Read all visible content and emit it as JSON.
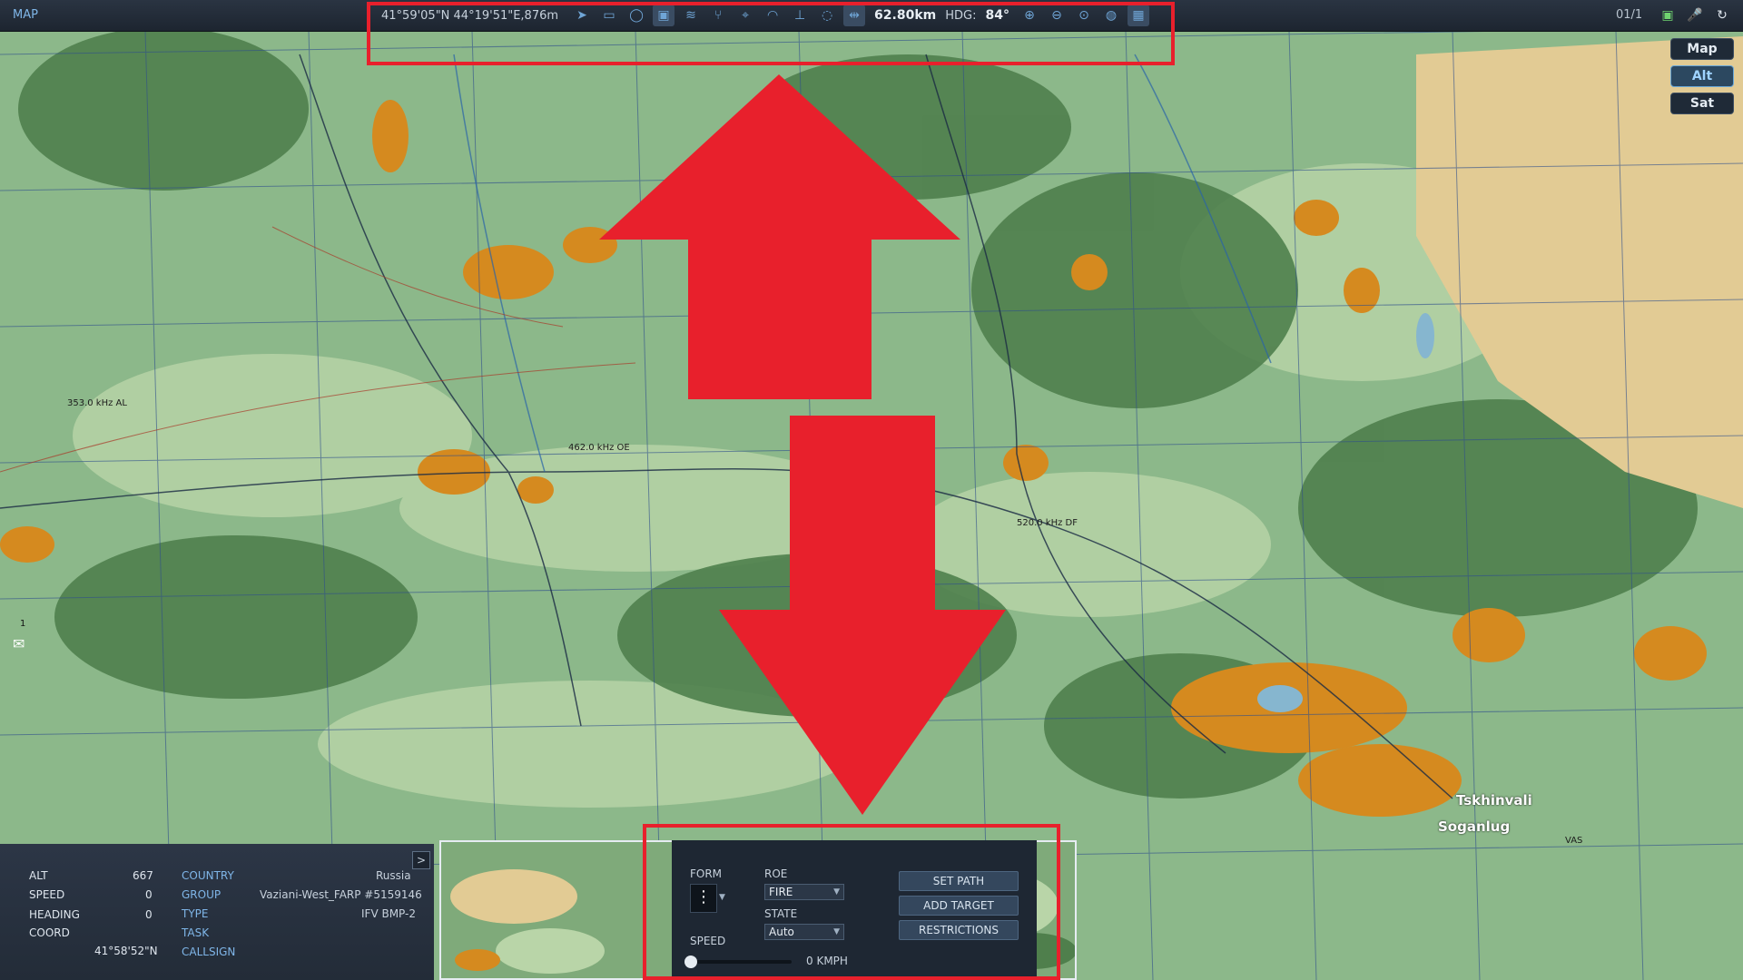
{
  "app": {
    "map_label": "MAP"
  },
  "toolbar": {
    "coordinates": "41°59'05\"N 44°19'51\"E,876m",
    "distance": "62.80km",
    "hdg_label": "HDG:",
    "hdg_value": "84°",
    "icons": [
      "navigate-icon",
      "ruler-icon",
      "circle-icon",
      "layers-icon",
      "terrain-icon",
      "route-icon",
      "target-icon",
      "wifi-icon",
      "tower-icon",
      "chat-icon",
      "measure-icon",
      "zoom-in-icon",
      "zoom-out-icon",
      "zoom-fit-icon",
      "globe-icon",
      "grid-icon"
    ]
  },
  "clock": "01/1",
  "layers": {
    "map": "Map",
    "alt": "Alt",
    "sat": "Sat"
  },
  "map_labels": {
    "ndb1": "353.0 kHz AL",
    "ndb2": "462.0 kHz OE",
    "ndb3": "520.0 kHz DF",
    "city1": "Tskhinvali",
    "city2": "Soganlug",
    "vas": "VAS",
    "mail_count": "1"
  },
  "unit_info": {
    "alt_label": "ALT",
    "alt_value": "667",
    "speed_label": "SPEED",
    "speed_value": "0",
    "heading_label": "HEADING",
    "heading_value": "0",
    "coord_label": "COORD",
    "coord_value": "41°58'52\"N",
    "country_label": "COUNTRY",
    "country_value": "Russia",
    "group_label": "GROUP",
    "group_value": "Vaziani-West_FARP #5159146",
    "type_label": "TYPE",
    "type_value": "IFV BMP-2",
    "task_label": "TASK",
    "callsign_label": "CALLSIGN",
    "expand": ">"
  },
  "unit_panel": {
    "form_label": "FORM",
    "roe_label": "ROE",
    "roe_value": "FIRE",
    "state_label": "STATE",
    "state_value": "Auto",
    "speed_label": "SPEED",
    "speed_value": "0 KMPH",
    "speed_fraction": 0,
    "set_path": "SET PATH",
    "add_target": "ADD TARGET",
    "restrictions": "RESTRICTIONS"
  },
  "colors": {
    "highlight": "#e8202c",
    "accent": "#7fb6e8"
  }
}
